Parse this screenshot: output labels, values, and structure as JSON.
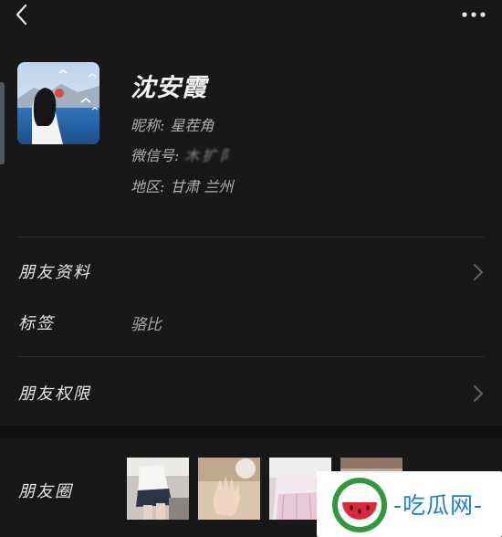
{
  "header": {
    "back_icon": "chevron-left-icon",
    "more_icon": "more-dots-icon"
  },
  "profile": {
    "avatar_icon": "avatar-photo",
    "name": "沈安霞",
    "nickname_label": "昵称:",
    "nickname": "星茬角",
    "wechat_id_label": "微信号:",
    "wechat_id": "木扩阝",
    "region_label": "地区:",
    "region": "甘肃  兰州"
  },
  "rows": {
    "friend_info": "朋友资料",
    "tags_label": "标签",
    "tags_value": "骆比",
    "friend_permissions": "朋友权限",
    "moments": "朋友圈"
  },
  "watermark": {
    "text": "-吃瓜网-",
    "logo_icon": "watermelon-logo-icon"
  },
  "colors": {
    "background": "#181818",
    "text_primary": "#e6e6e6",
    "text_secondary": "#a8a8a8",
    "divider": "#2c2c2c",
    "watermark_blue": "#1f7fd4"
  }
}
